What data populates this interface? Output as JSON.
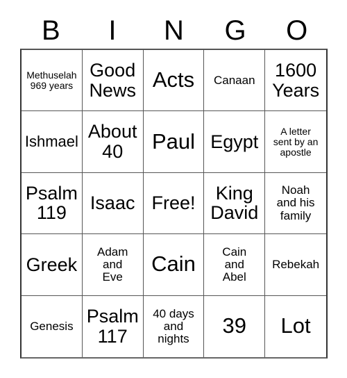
{
  "card": {
    "type": "bingo-card",
    "header_letters": [
      "B",
      "I",
      "N",
      "G",
      "O"
    ],
    "grid_size": "5x5",
    "free_space": "Free!",
    "colors": {
      "background": "#ffffff",
      "text": "#000000",
      "border": "#555555"
    },
    "cells": [
      {
        "text": "Methuselah\n969 years",
        "size": "xs"
      },
      {
        "text": "Good\nNews",
        "size": "lg"
      },
      {
        "text": "Acts",
        "size": "xl"
      },
      {
        "text": "Canaan",
        "size": "sm"
      },
      {
        "text": "1600\nYears",
        "size": "lg"
      },
      {
        "text": "Ishmael",
        "size": "md"
      },
      {
        "text": "About\n40",
        "size": "lg"
      },
      {
        "text": "Paul",
        "size": "xl"
      },
      {
        "text": "Egypt",
        "size": "lg"
      },
      {
        "text": "A letter\nsent by an\napostle",
        "size": "xs"
      },
      {
        "text": "Psalm\n119",
        "size": "lg"
      },
      {
        "text": "Isaac",
        "size": "lg"
      },
      {
        "text": "Free!",
        "size": "lg"
      },
      {
        "text": "King\nDavid",
        "size": "lg"
      },
      {
        "text": "Noah\nand his\nfamily",
        "size": "sm"
      },
      {
        "text": "Greek",
        "size": "lg"
      },
      {
        "text": "Adam\nand\nEve",
        "size": "sm"
      },
      {
        "text": "Cain",
        "size": "xl"
      },
      {
        "text": "Cain\nand\nAbel",
        "size": "sm"
      },
      {
        "text": "Rebekah",
        "size": "sm"
      },
      {
        "text": "Genesis",
        "size": "sm"
      },
      {
        "text": "Psalm\n117",
        "size": "lg"
      },
      {
        "text": "40 days\nand\nnights",
        "size": "sm"
      },
      {
        "text": "39",
        "size": "xl"
      },
      {
        "text": "Lot",
        "size": "xl"
      }
    ]
  }
}
